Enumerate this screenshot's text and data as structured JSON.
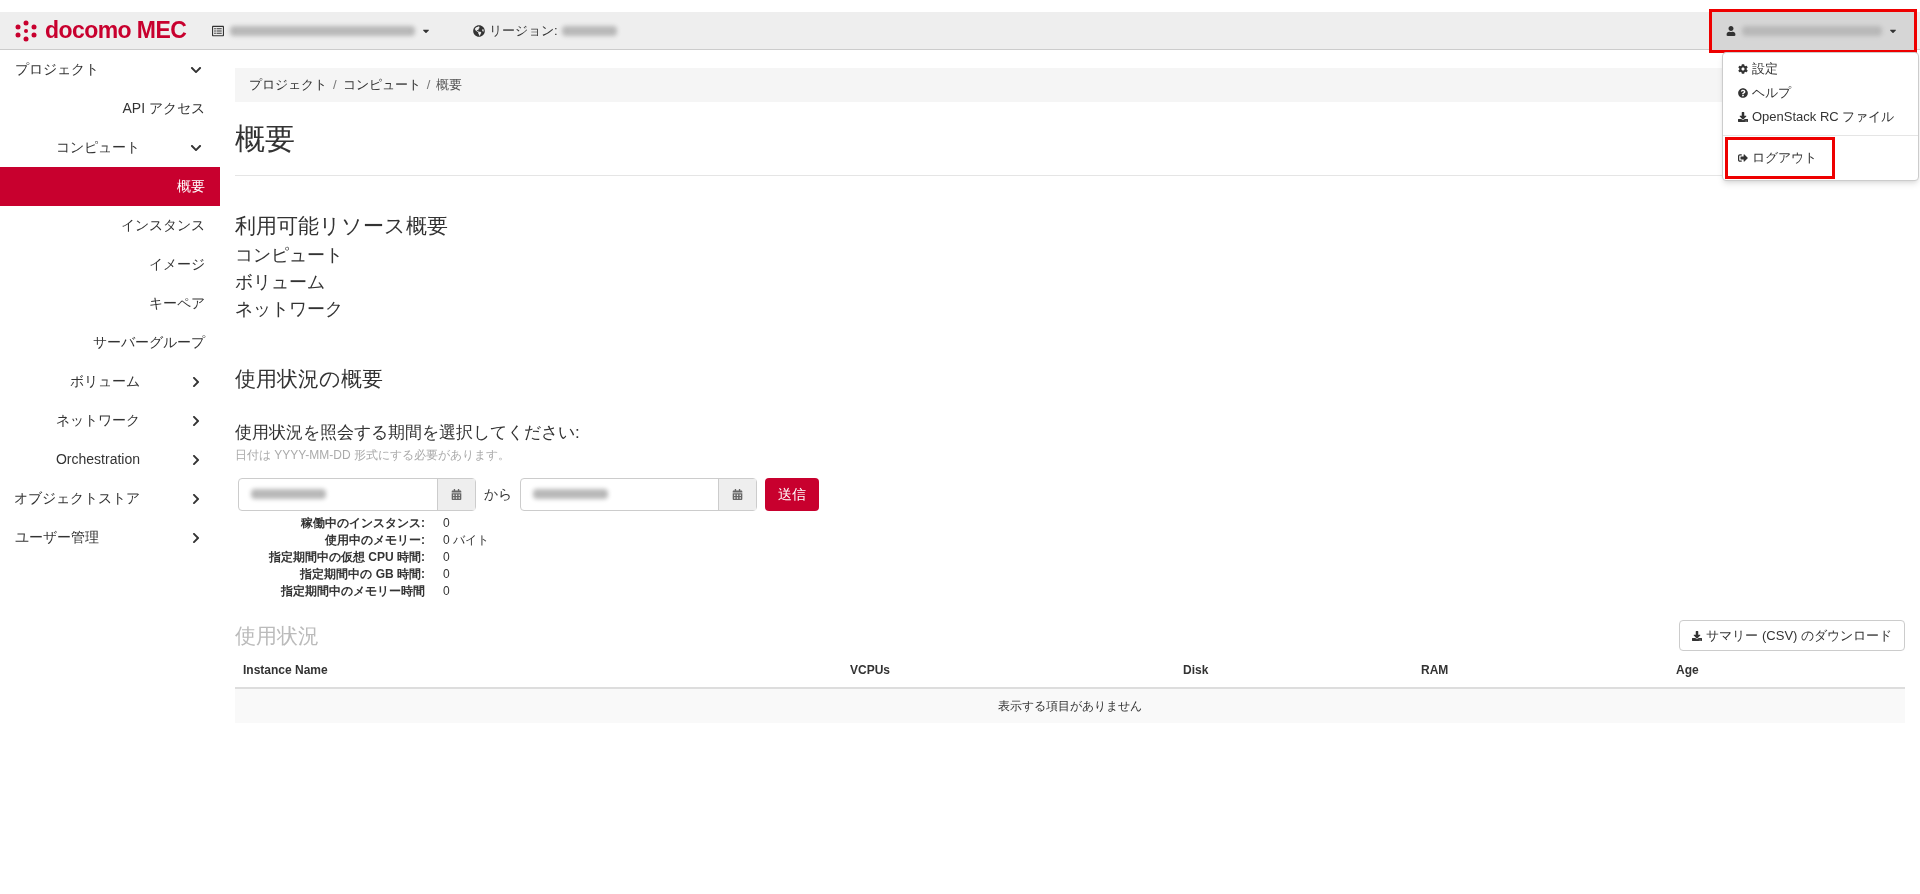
{
  "brand": {
    "name": "docomo MEC"
  },
  "topbar": {
    "region_label": "リージョン:"
  },
  "user_menu": {
    "highlighted": true,
    "expanded": true,
    "items": [
      {
        "kind": "settings",
        "label": "設定",
        "highlighted": false,
        "separated": false
      },
      {
        "kind": "help",
        "label": "ヘルプ",
        "highlighted": false,
        "separated": false
      },
      {
        "kind": "download",
        "label": "OpenStack RC ファイル",
        "highlighted": false,
        "separated": false
      },
      {
        "kind": "logout",
        "label": "ログアウト",
        "highlighted": true,
        "separated": true
      }
    ]
  },
  "sidebar": {
    "items": [
      {
        "kind": "group",
        "label": "プロジェクト",
        "expanded": true,
        "children": [
          {
            "kind": "link",
            "label": "API アクセス",
            "selected": false
          },
          {
            "kind": "group",
            "label": "コンピュート",
            "expanded": true,
            "children": [
              {
                "kind": "link",
                "label": "概要",
                "selected": true
              },
              {
                "kind": "link",
                "label": "インスタンス",
                "selected": false
              },
              {
                "kind": "link",
                "label": "イメージ",
                "selected": false
              },
              {
                "kind": "link",
                "label": "キーペア",
                "selected": false
              },
              {
                "kind": "link",
                "label": "サーバーグループ",
                "selected": false
              }
            ]
          },
          {
            "kind": "group",
            "label": "ボリューム",
            "expanded": false
          },
          {
            "kind": "group",
            "label": "ネットワーク",
            "expanded": false
          },
          {
            "kind": "group",
            "label": "Orchestration",
            "expanded": false
          },
          {
            "kind": "group",
            "label": "オブジェクトストア",
            "expanded": false
          }
        ]
      },
      {
        "kind": "group",
        "label": "ユーザー管理",
        "expanded": false
      }
    ]
  },
  "breadcrumb": {
    "separator": "/",
    "items": [
      "プロジェクト",
      "コンピュート",
      "概要"
    ]
  },
  "page_title": "概要",
  "resources": {
    "title": "利用可能リソース概要",
    "items": [
      "コンピュート",
      "ボリューム",
      "ネットワーク"
    ]
  },
  "usage_summary": {
    "title": "使用状況の概要",
    "prompt": "使用状況を照会する期間を選択してください:",
    "hint": "日付は YYYY-MM-DD 形式にする必要があります。",
    "separator": "から",
    "submit": "送信",
    "stats": [
      {
        "label": "稼働中のインスタンス:",
        "value": "0"
      },
      {
        "label": "使用中のメモリー:",
        "value": "0 バイト"
      },
      {
        "label": "指定期間中の仮想 CPU 時間:",
        "value": "0"
      },
      {
        "label": "指定期間中の GB 時間:",
        "value": "0"
      },
      {
        "label": "指定期間中のメモリー時間",
        "value": "0"
      }
    ]
  },
  "usage": {
    "title": "使用状況",
    "download_button": "サマリー (CSV) のダウンロード",
    "columns": [
      "Instance Name",
      "VCPUs",
      "Disk",
      "RAM",
      "Age"
    ],
    "empty_message": "表示する項目がありません"
  }
}
